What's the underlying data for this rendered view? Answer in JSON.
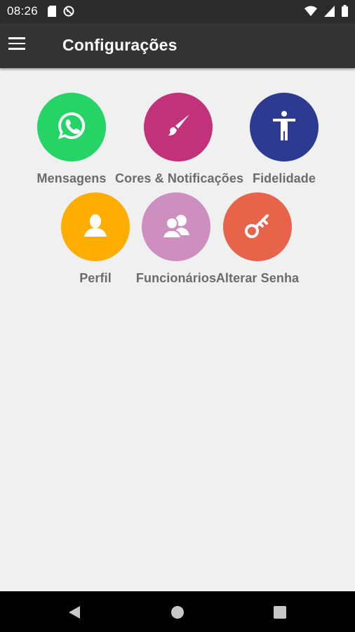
{
  "status_bar": {
    "time": "08:26"
  },
  "app_bar": {
    "title": "Configurações"
  },
  "tiles": [
    {
      "label": "Mensagens",
      "color": "#25d366",
      "icon": "whatsapp-icon"
    },
    {
      "label": "Cores & Notificações",
      "color": "#c2327a",
      "icon": "paintbrush-icon"
    },
    {
      "label": "Fidelidade",
      "color": "#2c3b8f",
      "icon": "accessibility-icon"
    },
    {
      "label": "Perfil",
      "color": "#ffad00",
      "icon": "person-icon"
    },
    {
      "label": "Funcionários",
      "color": "#cd8fc0",
      "icon": "group-icon"
    },
    {
      "label": "Alterar Senha",
      "color": "#e7644a",
      "icon": "key-icon"
    }
  ],
  "colors": {
    "background": "#f0f0f0",
    "app_bar": "#333333",
    "status_bar": "#2b2b2b",
    "nav_bar": "#000000"
  }
}
